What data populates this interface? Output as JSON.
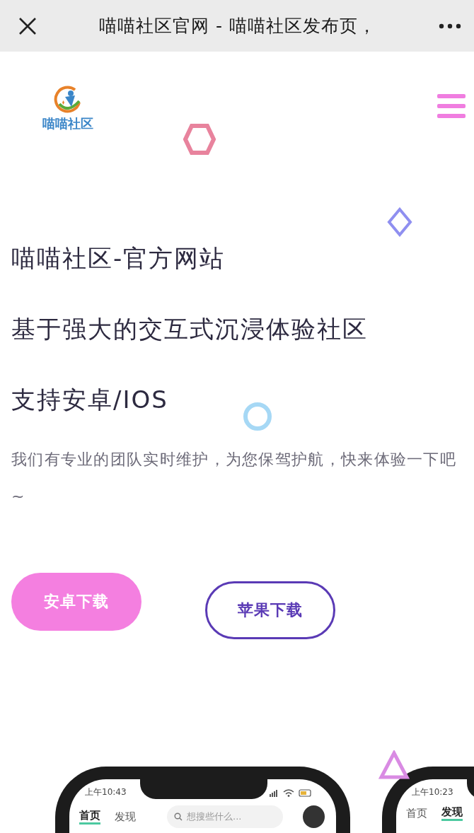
{
  "top_bar": {
    "title": "喵喵社区官网 - 喵喵社区发布页，"
  },
  "header": {
    "logo_text": "喵喵社区"
  },
  "headings": [
    "喵喵社区-官方网站",
    "基于强大的交互式沉浸体验社区",
    "支持安卓/IOS"
  ],
  "description": "我们有专业的团队实时维护，为您保驾护航，快来体验一下吧~",
  "buttons": [
    {
      "label": "安卓下载",
      "kind": "filled"
    },
    {
      "label": "苹果下载",
      "kind": "outline"
    }
  ],
  "phones": [
    {
      "time": "上午10:43",
      "tabs": [
        {
          "label": "首页",
          "selected": true
        },
        {
          "label": "发现",
          "selected": false
        }
      ],
      "search": {
        "placeholder": "想搜些什么..."
      }
    },
    {
      "time": "上午10:23",
      "tabs": [
        {
          "label": "首页",
          "selected": false
        },
        {
          "label": "发现",
          "selected": true
        }
      ]
    }
  ]
}
